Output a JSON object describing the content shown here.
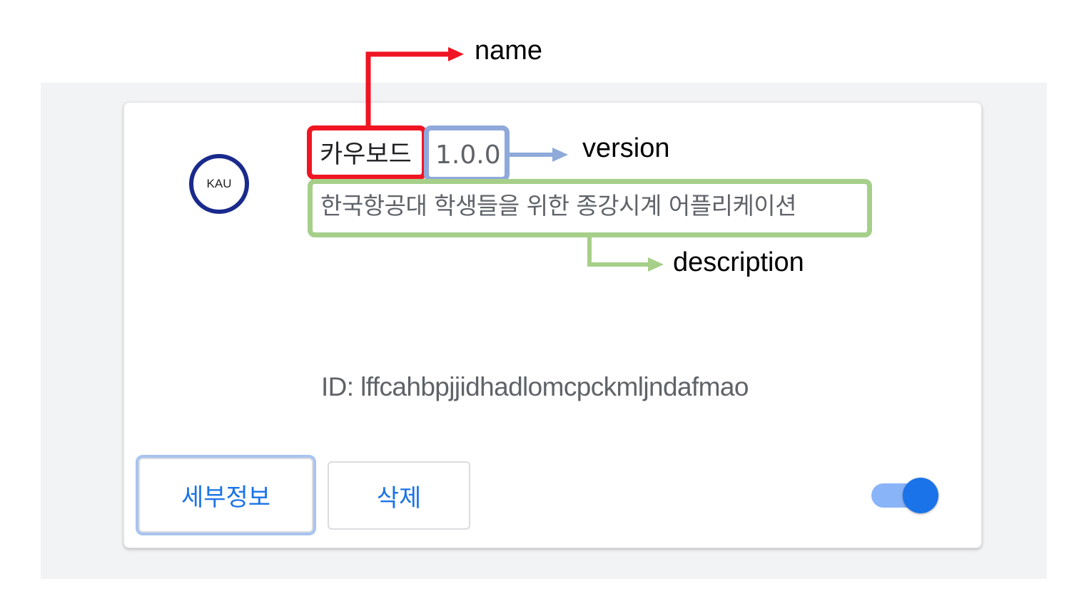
{
  "annotations": {
    "name_label": "name",
    "version_label": "version",
    "description_label": "description"
  },
  "extension": {
    "logo_text": "KAU",
    "name": "카우보드",
    "version": "1.0.0",
    "description": "한국항공대 학생들을 위한 종강시계 어플리케이션",
    "id": "ID: lffcahbpjjidhadlomcpckmljndafmao"
  },
  "buttons": {
    "details_label": "세부정보",
    "remove_label": "삭제"
  },
  "toggle": {
    "enabled": true
  },
  "colors": {
    "name_highlight": "#f01522",
    "version_highlight": "#8ea9da",
    "description_highlight": "#a6cf8a",
    "accent": "#1a73e8"
  }
}
